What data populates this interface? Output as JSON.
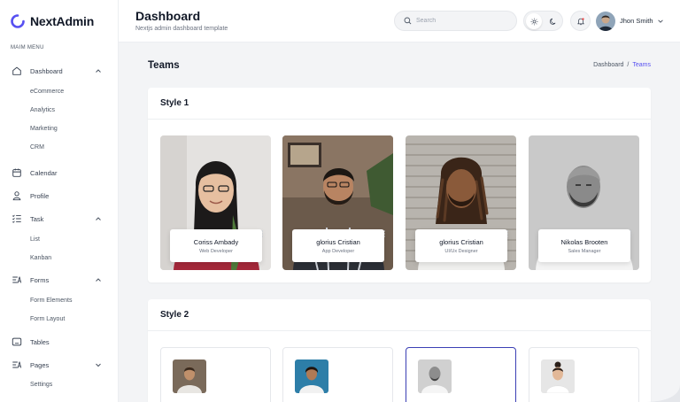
{
  "app": {
    "name": "NextAdmin",
    "accent": "#5750f1"
  },
  "sidebar": {
    "menu_title": "MAIM MENU",
    "items": [
      {
        "label": "Dashboard",
        "icon": "home-icon",
        "expanded": true
      },
      {
        "label": "eCommerce"
      },
      {
        "label": "Analytics"
      },
      {
        "label": "Marketing"
      },
      {
        "label": "CRM"
      },
      {
        "label": "Calendar",
        "icon": "calendar-icon"
      },
      {
        "label": "Profile",
        "icon": "user-icon"
      },
      {
        "label": "Task",
        "icon": "task-list-icon",
        "expanded": true
      },
      {
        "label": "List"
      },
      {
        "label": "Kanban"
      },
      {
        "label": "Forms",
        "icon": "form-icon",
        "expanded": true
      },
      {
        "label": "Form Elements"
      },
      {
        "label": "Form Layout"
      },
      {
        "label": "Tables",
        "icon": "table-icon"
      },
      {
        "label": "Pages",
        "icon": "pages-icon",
        "expanded": false
      },
      {
        "label": "Settings"
      }
    ]
  },
  "header": {
    "title": "Dashboard",
    "subtitle": "Nextjs admin dashboard template",
    "search_placeholder": "Search",
    "theme_active": "light",
    "user_name": "Jhon Smith"
  },
  "page": {
    "title": "Teams",
    "breadcrumb": {
      "parent": "Dashboard",
      "separator": "/",
      "current": "Teams"
    }
  },
  "style1": {
    "title": "Style 1",
    "members": [
      {
        "name": "Coriss Ambady",
        "role": "Web Developer"
      },
      {
        "name": "glorius Cristian",
        "role": "App Developer"
      },
      {
        "name": "glorius Cristian",
        "role": "UI/Ux Designer"
      },
      {
        "name": "Nikolas Brooten",
        "role": "Sales Manager"
      }
    ]
  },
  "style2": {
    "title": "Style 2",
    "selected_index": 2
  }
}
